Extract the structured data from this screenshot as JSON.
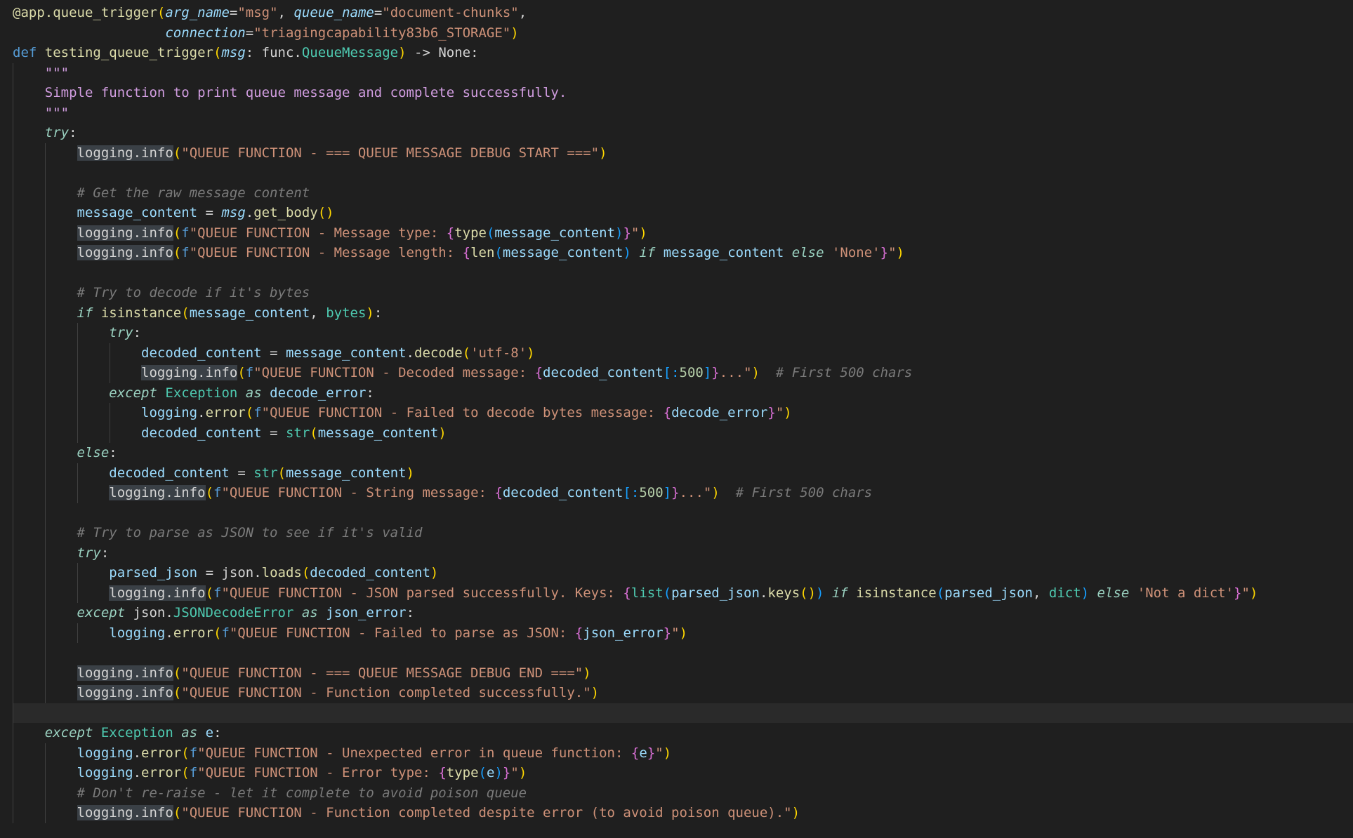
{
  "editor": {
    "language": "python",
    "current_line": 36,
    "colors": {
      "background": "#1f1f1f",
      "current_line": "#2a2a2a",
      "highlight": "#3a4046",
      "guide": "#404040"
    },
    "lines": [
      {
        "indent": 0,
        "tokens": [
          [
            "dec",
            "@app."
          ],
          [
            "fn",
            "queue_trigger"
          ],
          [
            "br1",
            "("
          ],
          [
            "param",
            "arg_name"
          ],
          [
            "plain",
            "="
          ],
          [
            "str",
            "\"msg\""
          ],
          [
            "plain",
            ", "
          ],
          [
            "param",
            "queue_name"
          ],
          [
            "plain",
            "="
          ],
          [
            "str",
            "\"document-chunks\""
          ],
          [
            "plain",
            ","
          ]
        ]
      },
      {
        "indent": 0,
        "tokens": [
          [
            "plain",
            "                   "
          ],
          [
            "param",
            "connection"
          ],
          [
            "plain",
            "="
          ],
          [
            "str",
            "\"triagingcapability83b6_STORAGE\""
          ],
          [
            "br1",
            ")"
          ]
        ]
      },
      {
        "indent": 0,
        "tokens": [
          [
            "kw",
            "def "
          ],
          [
            "fn",
            "testing_queue_trigger"
          ],
          [
            "br1",
            "("
          ],
          [
            "param",
            "msg"
          ],
          [
            "plain",
            ": func."
          ],
          [
            "cls",
            "QueueMessage"
          ],
          [
            "br1",
            ")"
          ],
          [
            "plain",
            " -> None:"
          ]
        ]
      },
      {
        "indent": 1,
        "tokens": [
          [
            "doc",
            "\"\"\""
          ]
        ]
      },
      {
        "indent": 1,
        "tokens": [
          [
            "doc",
            "Simple function to print queue message and complete successfully."
          ]
        ]
      },
      {
        "indent": 1,
        "tokens": [
          [
            "doc",
            "\"\"\""
          ]
        ]
      },
      {
        "indent": 1,
        "tokens": [
          [
            "kwi",
            "try"
          ],
          [
            "plain",
            ":"
          ]
        ]
      },
      {
        "indent": 2,
        "tokens": [
          [
            "hl",
            "logging.info"
          ],
          [
            "br1",
            "("
          ],
          [
            "str",
            "\"QUEUE FUNCTION - === QUEUE MESSAGE DEBUG START ===\""
          ],
          [
            "br1",
            ")"
          ]
        ]
      },
      {
        "indent": 2,
        "tokens": []
      },
      {
        "indent": 2,
        "tokens": [
          [
            "cmt",
            "# Get the raw message content"
          ]
        ]
      },
      {
        "indent": 2,
        "tokens": [
          [
            "var",
            "message_content"
          ],
          [
            "plain",
            " = "
          ],
          [
            "param",
            "msg"
          ],
          [
            "plain",
            "."
          ],
          [
            "fn",
            "get_body"
          ],
          [
            "br1",
            "()"
          ]
        ]
      },
      {
        "indent": 2,
        "tokens": [
          [
            "hl",
            "logging.info"
          ],
          [
            "br1",
            "("
          ],
          [
            "kw",
            "f"
          ],
          [
            "str",
            "\"QUEUE FUNCTION - Message type: "
          ],
          [
            "br2",
            "{"
          ],
          [
            "fn",
            "type"
          ],
          [
            "br3",
            "("
          ],
          [
            "var",
            "message_content"
          ],
          [
            "br3",
            ")"
          ],
          [
            "br2",
            "}"
          ],
          [
            "str",
            "\""
          ],
          [
            "br1",
            ")"
          ]
        ]
      },
      {
        "indent": 2,
        "tokens": [
          [
            "hl",
            "logging.info"
          ],
          [
            "br1",
            "("
          ],
          [
            "kw",
            "f"
          ],
          [
            "str",
            "\"QUEUE FUNCTION - Message length: "
          ],
          [
            "br2",
            "{"
          ],
          [
            "fn",
            "len"
          ],
          [
            "br3",
            "("
          ],
          [
            "var",
            "message_content"
          ],
          [
            "br3",
            ")"
          ],
          [
            "plain",
            " "
          ],
          [
            "kwi",
            "if"
          ],
          [
            "plain",
            " "
          ],
          [
            "var",
            "message_content"
          ],
          [
            "plain",
            " "
          ],
          [
            "kwi",
            "else"
          ],
          [
            "plain",
            " "
          ],
          [
            "str",
            "'None'"
          ],
          [
            "br2",
            "}"
          ],
          [
            "str",
            "\""
          ],
          [
            "br1",
            ")"
          ]
        ]
      },
      {
        "indent": 2,
        "tokens": []
      },
      {
        "indent": 2,
        "tokens": [
          [
            "cmt",
            "# Try to decode if it's bytes"
          ]
        ]
      },
      {
        "indent": 2,
        "tokens": [
          [
            "kwi",
            "if"
          ],
          [
            "plain",
            " "
          ],
          [
            "fn",
            "isinstance"
          ],
          [
            "br1",
            "("
          ],
          [
            "var",
            "message_content"
          ],
          [
            "plain",
            ", "
          ],
          [
            "cls",
            "bytes"
          ],
          [
            "br1",
            ")"
          ],
          [
            "plain",
            ":"
          ]
        ]
      },
      {
        "indent": 3,
        "tokens": [
          [
            "kwi",
            "try"
          ],
          [
            "plain",
            ":"
          ]
        ]
      },
      {
        "indent": 4,
        "tokens": [
          [
            "var",
            "decoded_content"
          ],
          [
            "plain",
            " = "
          ],
          [
            "var",
            "message_content"
          ],
          [
            "plain",
            "."
          ],
          [
            "fn",
            "decode"
          ],
          [
            "br1",
            "("
          ],
          [
            "str",
            "'utf-8'"
          ],
          [
            "br1",
            ")"
          ]
        ]
      },
      {
        "indent": 4,
        "tokens": [
          [
            "hl",
            "logging.info"
          ],
          [
            "br1",
            "("
          ],
          [
            "kw",
            "f"
          ],
          [
            "str",
            "\"QUEUE FUNCTION - Decoded message: "
          ],
          [
            "br2",
            "{"
          ],
          [
            "var",
            "decoded_content"
          ],
          [
            "br3",
            "[:"
          ],
          [
            "num",
            "500"
          ],
          [
            "br3",
            "]"
          ],
          [
            "br2",
            "}"
          ],
          [
            "str",
            "...\""
          ],
          [
            "br1",
            ")"
          ],
          [
            "plain",
            "  "
          ],
          [
            "cmt",
            "# First 500 chars"
          ]
        ]
      },
      {
        "indent": 3,
        "tokens": [
          [
            "kwi",
            "except"
          ],
          [
            "plain",
            " "
          ],
          [
            "cls",
            "Exception"
          ],
          [
            "plain",
            " "
          ],
          [
            "kwi",
            "as"
          ],
          [
            "plain",
            " "
          ],
          [
            "var",
            "decode_error"
          ],
          [
            "plain",
            ":"
          ]
        ]
      },
      {
        "indent": 4,
        "tokens": [
          [
            "var",
            "logging"
          ],
          [
            "plain",
            "."
          ],
          [
            "fn",
            "error"
          ],
          [
            "br1",
            "("
          ],
          [
            "kw",
            "f"
          ],
          [
            "str",
            "\"QUEUE FUNCTION - Failed to decode bytes message: "
          ],
          [
            "br2",
            "{"
          ],
          [
            "var",
            "decode_error"
          ],
          [
            "br2",
            "}"
          ],
          [
            "str",
            "\""
          ],
          [
            "br1",
            ")"
          ]
        ]
      },
      {
        "indent": 4,
        "tokens": [
          [
            "var",
            "decoded_content"
          ],
          [
            "plain",
            " = "
          ],
          [
            "cls",
            "str"
          ],
          [
            "br1",
            "("
          ],
          [
            "var",
            "message_content"
          ],
          [
            "br1",
            ")"
          ]
        ]
      },
      {
        "indent": 2,
        "tokens": [
          [
            "kwi",
            "else"
          ],
          [
            "plain",
            ":"
          ]
        ]
      },
      {
        "indent": 3,
        "tokens": [
          [
            "var",
            "decoded_content"
          ],
          [
            "plain",
            " = "
          ],
          [
            "cls",
            "str"
          ],
          [
            "br1",
            "("
          ],
          [
            "var",
            "message_content"
          ],
          [
            "br1",
            ")"
          ]
        ]
      },
      {
        "indent": 3,
        "tokens": [
          [
            "hl",
            "logging.info"
          ],
          [
            "br1",
            "("
          ],
          [
            "kw",
            "f"
          ],
          [
            "str",
            "\"QUEUE FUNCTION - String message: "
          ],
          [
            "br2",
            "{"
          ],
          [
            "var",
            "decoded_content"
          ],
          [
            "br3",
            "[:"
          ],
          [
            "num",
            "500"
          ],
          [
            "br3",
            "]"
          ],
          [
            "br2",
            "}"
          ],
          [
            "str",
            "...\""
          ],
          [
            "br1",
            ")"
          ],
          [
            "plain",
            "  "
          ],
          [
            "cmt",
            "# First 500 chars"
          ]
        ]
      },
      {
        "indent": 2,
        "tokens": []
      },
      {
        "indent": 2,
        "tokens": [
          [
            "cmt",
            "# Try to parse as JSON to see if it's valid"
          ]
        ]
      },
      {
        "indent": 2,
        "tokens": [
          [
            "kwi",
            "try"
          ],
          [
            "plain",
            ":"
          ]
        ]
      },
      {
        "indent": 3,
        "tokens": [
          [
            "var",
            "parsed_json"
          ],
          [
            "plain",
            " = json."
          ],
          [
            "fn",
            "loads"
          ],
          [
            "br1",
            "("
          ],
          [
            "var",
            "decoded_content"
          ],
          [
            "br1",
            ")"
          ]
        ]
      },
      {
        "indent": 3,
        "tokens": [
          [
            "hl",
            "logging.info"
          ],
          [
            "br1",
            "("
          ],
          [
            "kw",
            "f"
          ],
          [
            "str",
            "\"QUEUE FUNCTION - JSON parsed successfully. Keys: "
          ],
          [
            "br2",
            "{"
          ],
          [
            "cls",
            "list"
          ],
          [
            "br3",
            "("
          ],
          [
            "var",
            "parsed_json"
          ],
          [
            "plain",
            "."
          ],
          [
            "fn",
            "keys"
          ],
          [
            "br1",
            "()"
          ],
          [
            "br3",
            ")"
          ],
          [
            "plain",
            " "
          ],
          [
            "kwi",
            "if"
          ],
          [
            "plain",
            " "
          ],
          [
            "fn",
            "isinstance"
          ],
          [
            "br3",
            "("
          ],
          [
            "var",
            "parsed_json"
          ],
          [
            "plain",
            ", "
          ],
          [
            "cls",
            "dict"
          ],
          [
            "br3",
            ")"
          ],
          [
            "plain",
            " "
          ],
          [
            "kwi",
            "else"
          ],
          [
            "plain",
            " "
          ],
          [
            "str",
            "'Not a dict'"
          ],
          [
            "br2",
            "}"
          ],
          [
            "str",
            "\""
          ],
          [
            "br1",
            ")"
          ]
        ]
      },
      {
        "indent": 2,
        "tokens": [
          [
            "kwi",
            "except"
          ],
          [
            "plain",
            " json."
          ],
          [
            "cls",
            "JSONDecodeError"
          ],
          [
            "plain",
            " "
          ],
          [
            "kwi",
            "as"
          ],
          [
            "plain",
            " "
          ],
          [
            "var",
            "json_error"
          ],
          [
            "plain",
            ":"
          ]
        ]
      },
      {
        "indent": 3,
        "tokens": [
          [
            "var",
            "logging"
          ],
          [
            "plain",
            "."
          ],
          [
            "fn",
            "error"
          ],
          [
            "br1",
            "("
          ],
          [
            "kw",
            "f"
          ],
          [
            "str",
            "\"QUEUE FUNCTION - Failed to parse as JSON: "
          ],
          [
            "br2",
            "{"
          ],
          [
            "var",
            "json_error"
          ],
          [
            "br2",
            "}"
          ],
          [
            "str",
            "\""
          ],
          [
            "br1",
            ")"
          ]
        ]
      },
      {
        "indent": 2,
        "tokens": []
      },
      {
        "indent": 2,
        "tokens": [
          [
            "hl",
            "logging.info"
          ],
          [
            "br1",
            "("
          ],
          [
            "str",
            "\"QUEUE FUNCTION - === QUEUE MESSAGE DEBUG END ===\""
          ],
          [
            "br1",
            ")"
          ]
        ]
      },
      {
        "indent": 2,
        "tokens": [
          [
            "hl",
            "logging.info"
          ],
          [
            "br1",
            "("
          ],
          [
            "str",
            "\"QUEUE FUNCTION - Function completed successfully.\""
          ],
          [
            "br1",
            ")"
          ]
        ]
      },
      {
        "indent": 1,
        "tokens": []
      },
      {
        "indent": 1,
        "tokens": [
          [
            "kwi",
            "except"
          ],
          [
            "plain",
            " "
          ],
          [
            "cls",
            "Exception"
          ],
          [
            "plain",
            " "
          ],
          [
            "kwi",
            "as"
          ],
          [
            "plain",
            " "
          ],
          [
            "var",
            "e"
          ],
          [
            "plain",
            ":"
          ]
        ]
      },
      {
        "indent": 2,
        "tokens": [
          [
            "var",
            "logging"
          ],
          [
            "plain",
            "."
          ],
          [
            "fn",
            "error"
          ],
          [
            "br1",
            "("
          ],
          [
            "kw",
            "f"
          ],
          [
            "str",
            "\"QUEUE FUNCTION - Unexpected error in queue function: "
          ],
          [
            "br2",
            "{"
          ],
          [
            "var",
            "e"
          ],
          [
            "br2",
            "}"
          ],
          [
            "str",
            "\""
          ],
          [
            "br1",
            ")"
          ]
        ]
      },
      {
        "indent": 2,
        "tokens": [
          [
            "var",
            "logging"
          ],
          [
            "plain",
            "."
          ],
          [
            "fn",
            "error"
          ],
          [
            "br1",
            "("
          ],
          [
            "kw",
            "f"
          ],
          [
            "str",
            "\"QUEUE FUNCTION - Error type: "
          ],
          [
            "br2",
            "{"
          ],
          [
            "fn",
            "type"
          ],
          [
            "br3",
            "("
          ],
          [
            "var",
            "e"
          ],
          [
            "br3",
            ")"
          ],
          [
            "br2",
            "}"
          ],
          [
            "str",
            "\""
          ],
          [
            "br1",
            ")"
          ]
        ]
      },
      {
        "indent": 2,
        "tokens": [
          [
            "cmt",
            "# Don't re-raise - let it complete to avoid poison queue"
          ]
        ]
      },
      {
        "indent": 2,
        "tokens": [
          [
            "hl",
            "logging.info"
          ],
          [
            "br1",
            "("
          ],
          [
            "str",
            "\"QUEUE FUNCTION - Function completed despite error (to avoid poison queue).\""
          ],
          [
            "br1",
            ")"
          ]
        ]
      }
    ]
  }
}
